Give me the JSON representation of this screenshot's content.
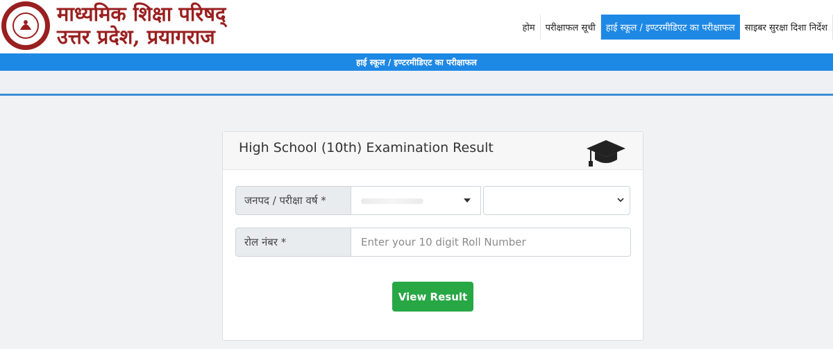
{
  "header": {
    "brand_line1": "माध्यमिक शिक्षा परिषद्",
    "brand_line2": "उत्तर प्रदेश, प्रयागराज",
    "nav": [
      {
        "label": "होम"
      },
      {
        "label": "परीक्षाफल सूची"
      },
      {
        "label": "हाई स्कूल / इण्टरमीडिएट का परीक्षाफल"
      },
      {
        "label": "साइबर सुरक्षा दिशा निर्देश"
      }
    ],
    "active_color": "#1e88e5",
    "brand_color": "#9a1f1f"
  },
  "banner": {
    "text": "हाई स्कूल / इण्टरमीडिएट का परीक्षाफल"
  },
  "card": {
    "title": "High School (10th) Examination Result",
    "icon": "graduation-cap-icon",
    "district_label": "जनपद / परीक्षा वर्ष *",
    "roll_label": "रोल नंबर *",
    "roll_placeholder": "Enter your 10 digit Roll Number",
    "submit_label": "View Result",
    "submit_color": "#28a745"
  }
}
